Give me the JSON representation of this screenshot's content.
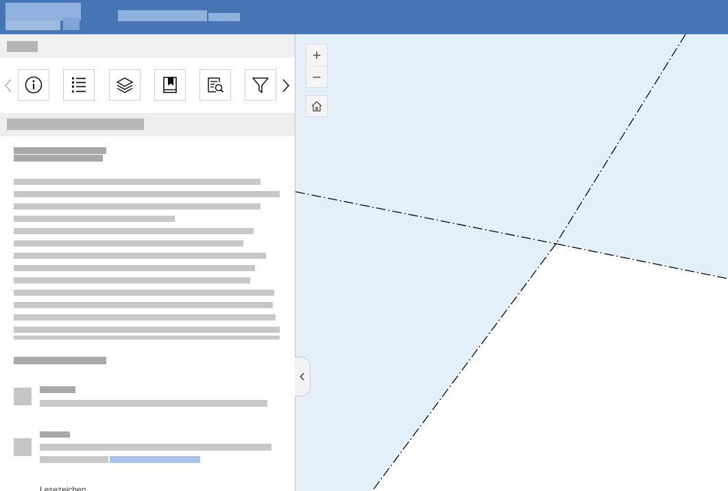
{
  "header": {
    "logo_icon": "app-logo",
    "title_label": "",
    "color": "#4575b5"
  },
  "panel": {
    "title": "",
    "section_title": ""
  },
  "toolbar": {
    "prev_icon": "chevron-left-icon",
    "next_icon": "chevron-right-icon",
    "buttons": [
      {
        "icon": "info-icon"
      },
      {
        "icon": "list-icon"
      },
      {
        "icon": "layers-icon"
      },
      {
        "icon": "bookmark-icon"
      },
      {
        "icon": "search-document-icon"
      },
      {
        "icon": "filter-icon"
      }
    ]
  },
  "content": {
    "legend_label": "Lesezeichen"
  },
  "map": {
    "zoom_in_label": "+",
    "zoom_out_label": "−",
    "home_icon": "home-icon",
    "shaded_color": "#e3f0f9",
    "boundary_color": "#000000"
  },
  "panel_toggle_icon": "chevron-left-icon"
}
